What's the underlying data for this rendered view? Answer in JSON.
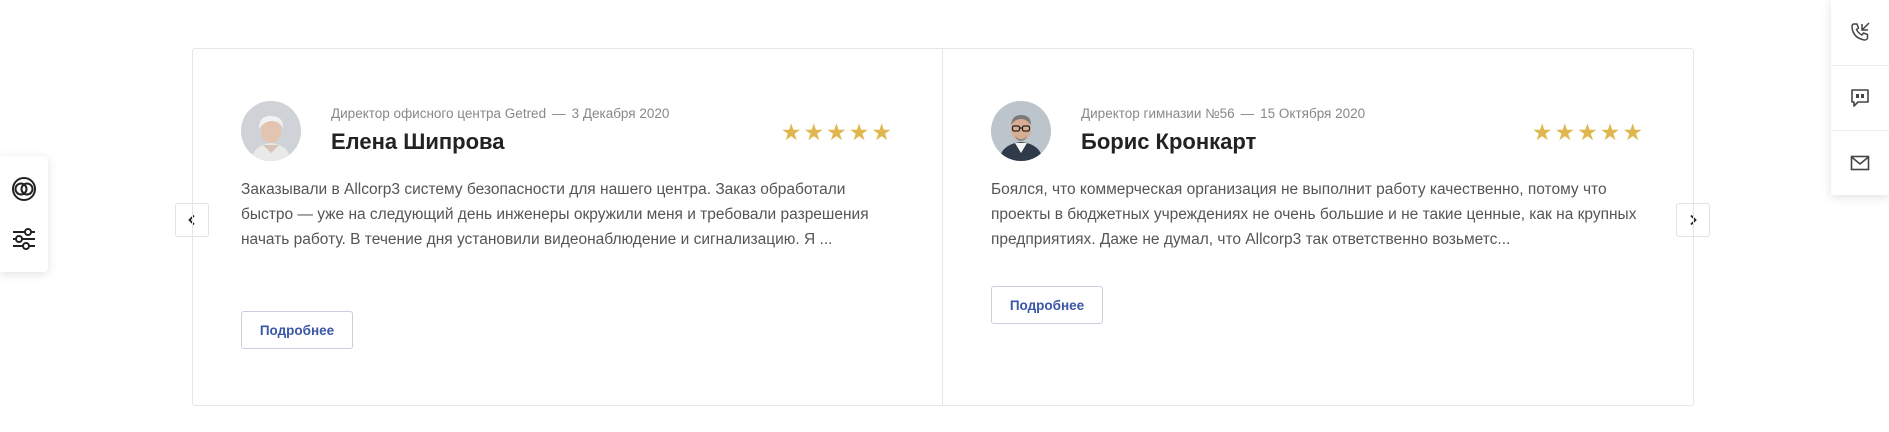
{
  "left_toolbar": {
    "items": [
      {
        "icon": "theme-icon"
      },
      {
        "icon": "settings-sliders-icon"
      }
    ]
  },
  "right_toolbar": {
    "items": [
      {
        "icon": "callback-phone-icon"
      },
      {
        "icon": "chat-icon"
      },
      {
        "icon": "mail-icon"
      }
    ]
  },
  "colors": {
    "star": "#e0b74f",
    "button_text": "#3a57a7",
    "border": "#e6e6e6"
  },
  "reviews": [
    {
      "position": "Директор офисного центра Getred",
      "date": "3 Декабря 2020",
      "name": "Елена Шипрова",
      "rating": 5,
      "stars": "★★★★★",
      "text": "Заказывали в Allcorp3 систему безопасности для нашего центра. Заказ обработали быстро — уже на следующий день инженеры окружили меня и требовали разрешения начать работу. В течение дня установили видеонаблюдение и сигнализацию. Я ...",
      "more_label": "Подробнее"
    },
    {
      "position": "Директор гимназии №56",
      "date": "15 Октября 2020",
      "name": "Борис Кронкарт",
      "rating": 5,
      "stars": "★★★★★",
      "text": "Боялся, что коммерческая организация не выполнит работу качественно, потому что проекты в бюджетных учреждениях не очень большие и не такие ценные, как на крупных предприятиях. Даже не думал, что Allcorp3 так ответственно возьметс...",
      "more_label": "Подробнее"
    }
  ],
  "dash": "—",
  "nav": {
    "prev_icon": "chevron-left-icon",
    "next_icon": "chevron-right-icon"
  }
}
